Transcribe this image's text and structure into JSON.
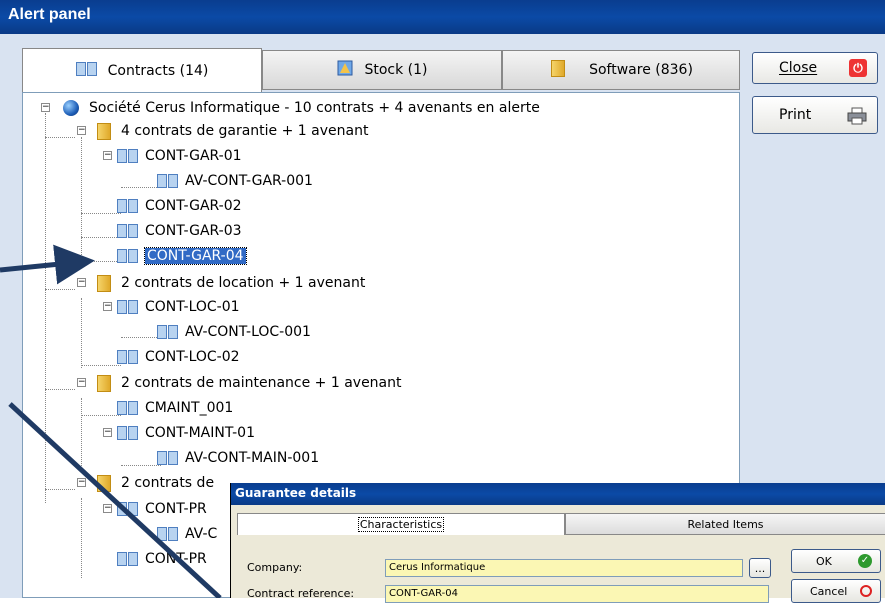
{
  "window": {
    "title": "Alert panel"
  },
  "tabs": [
    {
      "label": "Contracts (14)",
      "icon": "book-icon",
      "active": true
    },
    {
      "label": "Stock (1)",
      "icon": "stock-icon",
      "active": false
    },
    {
      "label": "Software (836)",
      "icon": "folder-icon",
      "active": false
    }
  ],
  "buttons": {
    "close_label": "Close",
    "print_label": "Print"
  },
  "tree": {
    "root": "Société Cerus Informatique - 10 contrats + 4 avenants en alerte",
    "g1": "4 contrats de garantie + 1 avenant",
    "g1c1": "CONT-GAR-01",
    "g1c1a": "AV-CONT-GAR-001",
    "g1c2": "CONT-GAR-02",
    "g1c3": "CONT-GAR-03",
    "g1c4": "CONT-GAR-04",
    "g2": "2 contrats de location + 1 avenant",
    "g2c1": "CONT-LOC-01",
    "g2c1a": "AV-CONT-LOC-001",
    "g2c2": "CONT-LOC-02",
    "g3": "2 contrats de maintenance + 1 avenant",
    "g3c1": "CMAINT_001",
    "g3c2": "CONT-MAINT-01",
    "g3c2a": "AV-CONT-MAIN-001",
    "g4": "2 contrats de",
    "g4c1": "CONT-PR",
    "g4c1a": "AV-C",
    "g4c2": "CONT-PR"
  },
  "dialog": {
    "title": "Guarantee details",
    "tab_characteristics": "Characteristics",
    "tab_related": "Related Items",
    "company_label": "Company:",
    "company_value": "Cerus Informatique",
    "browse_label": "...",
    "contract_ref_label": "Contract reference:",
    "contract_ref_value": "CONT-GAR-04",
    "ok_label": "OK",
    "cancel_label": "Cancel"
  },
  "colors": {
    "title_bar": "#0b4aa6",
    "selection": "#316ac5",
    "field_bg": "#fbf7b4",
    "panel": "#d9e3f1"
  }
}
